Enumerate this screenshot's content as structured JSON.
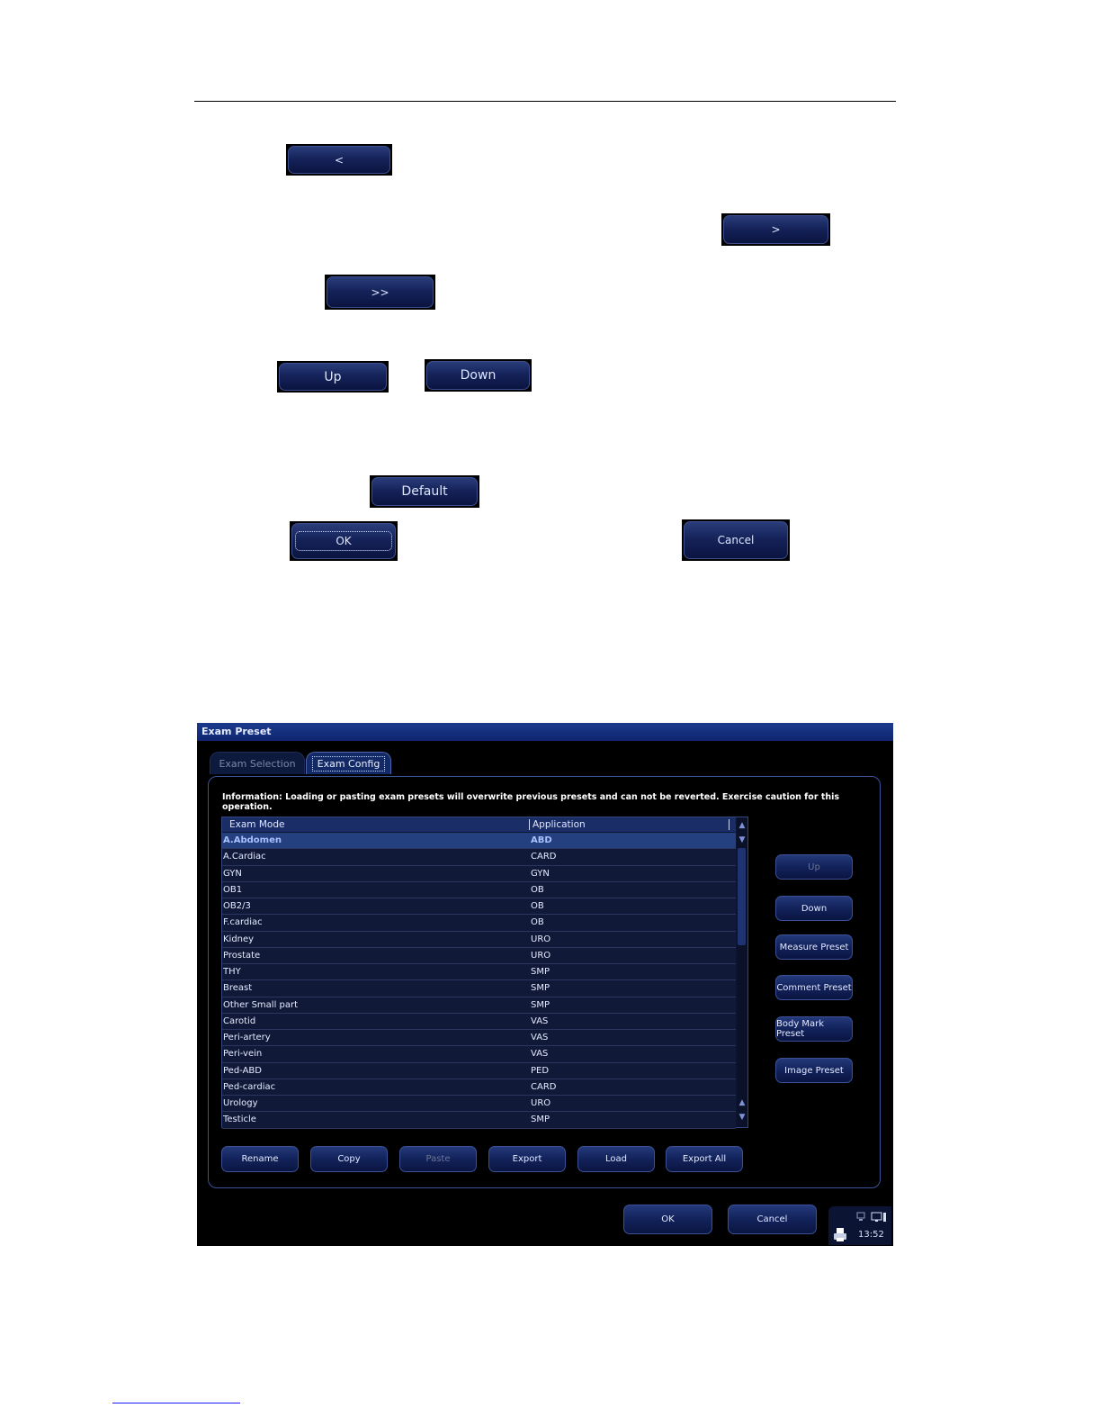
{
  "samples": {
    "prev": "<",
    "next": ">",
    "all": ">>",
    "up": "Up",
    "down": "Down",
    "default": "Default",
    "ok": "OK",
    "cancel": "Cancel"
  },
  "window": {
    "title": "Exam Preset",
    "tabs": [
      "Exam Selection",
      "Exam Config"
    ],
    "info": "Information: Loading or pasting exam presets will overwrite previous presets and can not be reverted. Exercise caution for this operation.",
    "columns": [
      "Exam Mode",
      "Application"
    ],
    "rows": [
      {
        "mode": "A.Abdomen",
        "app": "ABD"
      },
      {
        "mode": "A.Cardiac",
        "app": "CARD"
      },
      {
        "mode": "GYN",
        "app": "GYN"
      },
      {
        "mode": "OB1",
        "app": "OB"
      },
      {
        "mode": "OB2/3",
        "app": "OB"
      },
      {
        "mode": "F.cardiac",
        "app": "OB"
      },
      {
        "mode": "Kidney",
        "app": "URO"
      },
      {
        "mode": "Prostate",
        "app": "URO"
      },
      {
        "mode": "THY",
        "app": "SMP"
      },
      {
        "mode": "Breast",
        "app": "SMP"
      },
      {
        "mode": "Other Small part",
        "app": "SMP"
      },
      {
        "mode": "Carotid",
        "app": "VAS"
      },
      {
        "mode": "Peri-artery",
        "app": "VAS"
      },
      {
        "mode": "Peri-vein",
        "app": "VAS"
      },
      {
        "mode": "Ped-ABD",
        "app": "PED"
      },
      {
        "mode": "Ped-cardiac",
        "app": "CARD"
      },
      {
        "mode": "Urology",
        "app": "URO"
      },
      {
        "mode": "Testicle",
        "app": "SMP"
      }
    ],
    "side_buttons": [
      "Up",
      "Down",
      "Measure Preset",
      "Comment Preset",
      "Body Mark Preset",
      "Image Preset"
    ],
    "bottom_buttons": [
      "Rename",
      "Copy",
      "Paste",
      "Export",
      "Load",
      "Export All"
    ],
    "ok": "OK",
    "cancel": "Cancel",
    "clock": "13:52"
  }
}
